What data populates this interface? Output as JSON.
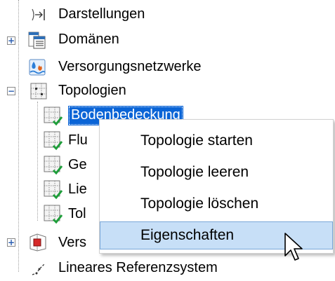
{
  "tree": {
    "items": [
      {
        "label": "Darstellungen",
        "icon": "representation-arrow-icon"
      },
      {
        "label": "Domänen",
        "icon": "domains-table-icon",
        "expander": "+"
      },
      {
        "label": "Versorgungsnetzwerke",
        "icon": "utility-network-icon"
      },
      {
        "label": "Topologien",
        "icon": "topology-grid-icon",
        "expander": "−"
      },
      {
        "label": "Bodenbedeckung",
        "icon": "topology-check-icon"
      },
      {
        "label": "Flu",
        "icon": "topology-check-icon"
      },
      {
        "label": "Ge",
        "icon": "topology-check-icon"
      },
      {
        "label": "Lie",
        "icon": "topology-check-icon"
      },
      {
        "label": "Tol",
        "icon": "topology-check-icon"
      },
      {
        "label": "Vers",
        "icon": "parcel-fabric-icon",
        "expander": "+"
      },
      {
        "label": "Lineares Referenzsystem",
        "icon": "linear-referencing-icon"
      }
    ]
  },
  "context_menu": {
    "items": [
      {
        "label": "Topologie starten"
      },
      {
        "label": "Topologie leeren"
      },
      {
        "label": "Topologie löschen"
      },
      {
        "label": "Eigenschaften"
      }
    ]
  },
  "colors": {
    "selection": "#0a64d6",
    "menu_hover": "#c7dff7",
    "check_green": "#1e9e3a"
  }
}
